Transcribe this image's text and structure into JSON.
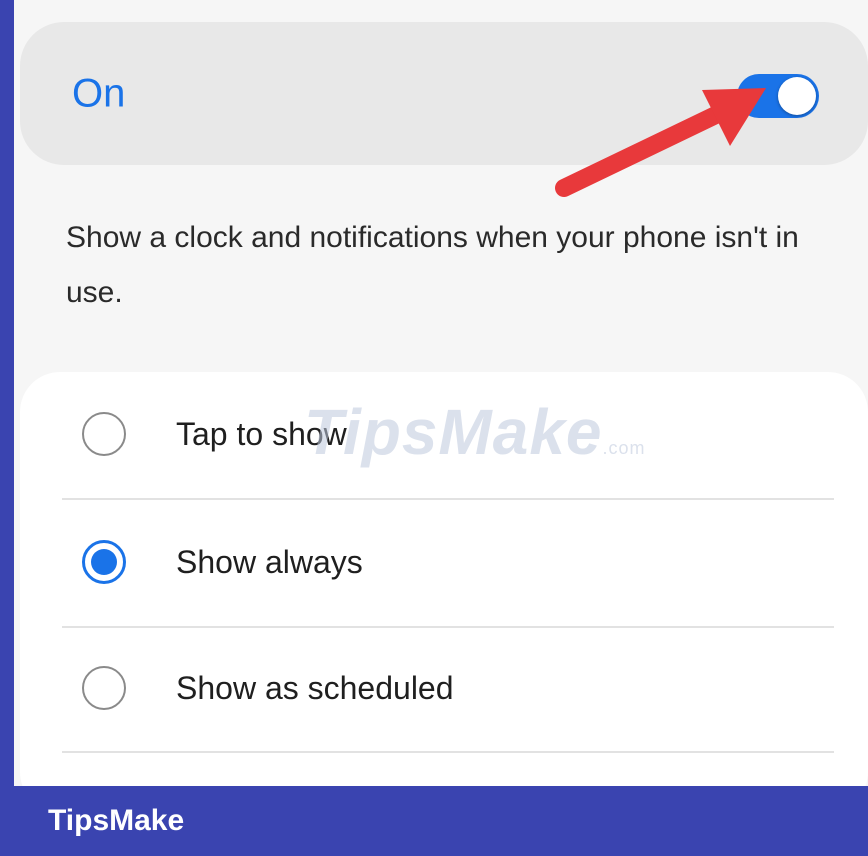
{
  "toggle": {
    "label": "On",
    "state": "on",
    "accent_color": "#1a73e8"
  },
  "description": "Show a clock and notifications when your phone isn't in use.",
  "options": [
    {
      "label": "Tap to show",
      "selected": false
    },
    {
      "label": "Show always",
      "selected": true
    },
    {
      "label": "Show as scheduled",
      "selected": false
    }
  ],
  "watermark": {
    "center": "TipsMake",
    "center_suffix": ".com",
    "footer": "TipsMake"
  },
  "annotation": {
    "arrow_color": "#e8393b",
    "arrow_target": "toggle-switch"
  }
}
